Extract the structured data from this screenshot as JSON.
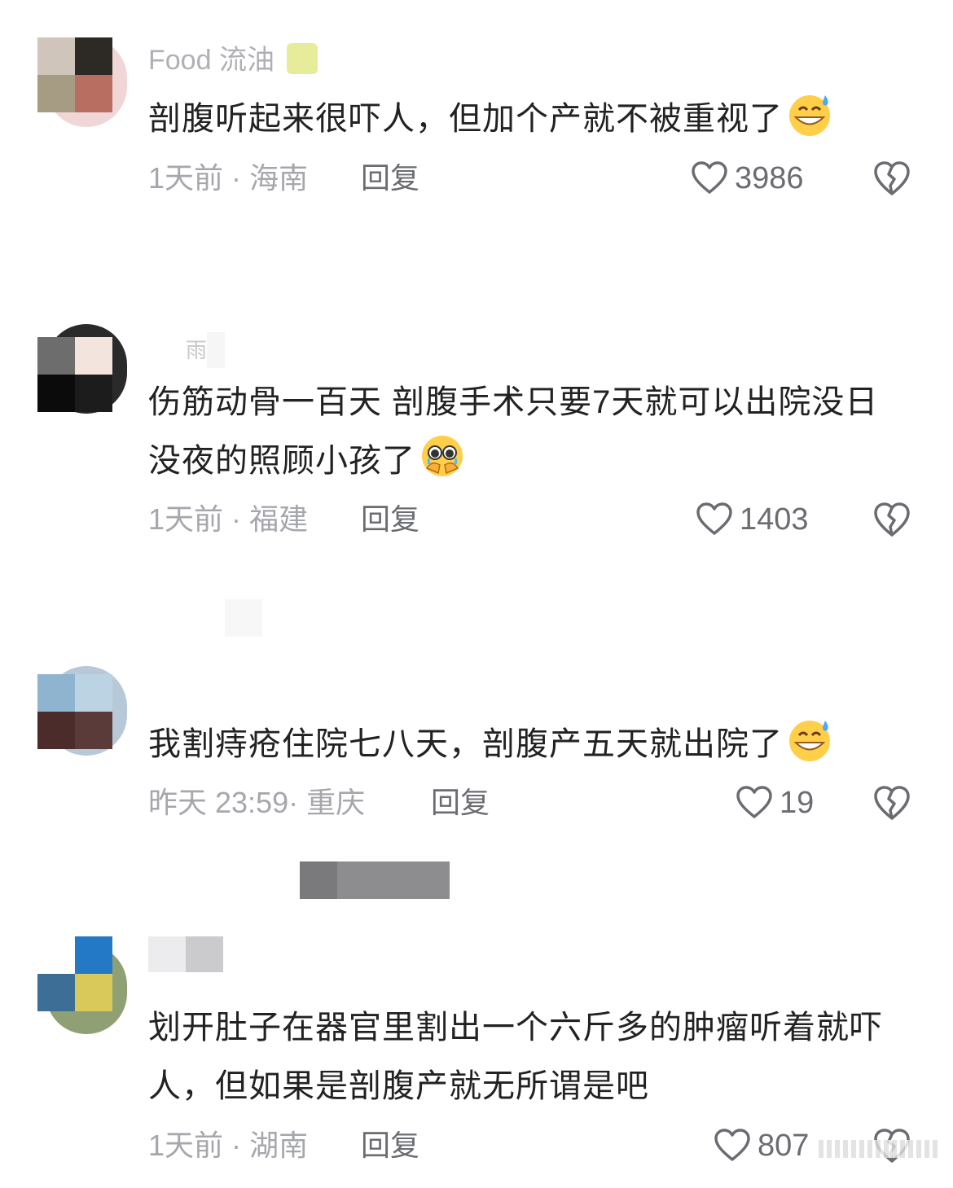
{
  "comments": [
    {
      "username": "Food 流油",
      "text": "剖腹听起来很吓人，但加个产就不被重视了",
      "emoji": "grinning-sweat-emoji",
      "time": "1天前",
      "sep": "·",
      "location": "海南",
      "reply": "回复",
      "likes": "3986"
    },
    {
      "username": "雨",
      "text": "伤筋动骨一百天 剖腹手术只要7天就可以出院没日没夜的照顾小孩了",
      "emoji": "holding-back-tears-emoji",
      "time": "1天前",
      "sep": "·",
      "location": "福建",
      "reply": "回复",
      "likes": "1403"
    },
    {
      "username": "",
      "text": "我割痔疮住院七八天，剖腹产五天就出院了",
      "emoji": "grinning-sweat-emoji",
      "time": "昨天 23:59",
      "sep": "·",
      "location": "重庆",
      "reply": "回复",
      "likes": "19"
    },
    {
      "username": "",
      "text": "划开肚子在器官里割出一个六斤多的肿瘤听着就吓人，但如果是剖腹产就无所谓是吧",
      "emoji": "",
      "time": "1天前",
      "sep": "·",
      "location": "湖南",
      "reply": "回复",
      "likes": "807"
    }
  ],
  "icons": {
    "like": "heart-outline-icon",
    "dislike": "broken-heart-icon"
  }
}
